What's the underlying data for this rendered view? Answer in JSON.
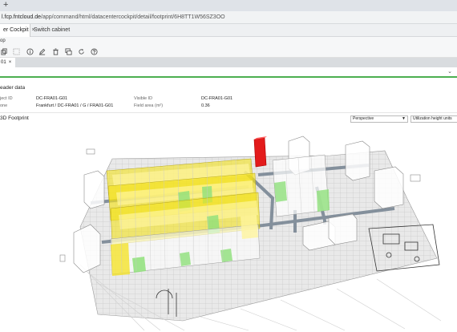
{
  "browser": {
    "new_tab": "+",
    "url_host": "l.fcp.fntcloud.de",
    "url_path": "/app/command/html/datacentercockpit/detail/footprint/6H8TT1W56SZ3OO"
  },
  "tabs": [
    {
      "label": "er Cockpit",
      "close": "×"
    },
    {
      "label": "Switch cabinet"
    }
  ],
  "menu": {
    "label": "op"
  },
  "toolbar": {
    "icons": [
      "copy-icon",
      "select-icon",
      "info-icon",
      "edit-icon",
      "delete-icon",
      "layers-icon",
      "refresh-icon",
      "help-icon"
    ]
  },
  "subtab": {
    "label": "01",
    "close": "×"
  },
  "header_data": {
    "title": "eader data",
    "object_id_label": "ject ID",
    "object_id_value": "DC-FRA01-G01",
    "visible_id_label": "Visible ID",
    "visible_id_value": "DC-FRA01-G01",
    "zone_label": "one",
    "zone_value": "Frankfurt / DC-FRA01 / G / FRA01-G01",
    "field_area_label": "Field area (m²)",
    "field_area_value": "0.36"
  },
  "footprint": {
    "title": "3D Footprint",
    "view_select": "Perspective",
    "mode_select": "Utilization height units"
  },
  "colors": {
    "accent_green": "#4caf50",
    "rack_yellow": "#f4e21c",
    "rack_green": "#8fe07a",
    "selected_red": "#e31b1b"
  }
}
